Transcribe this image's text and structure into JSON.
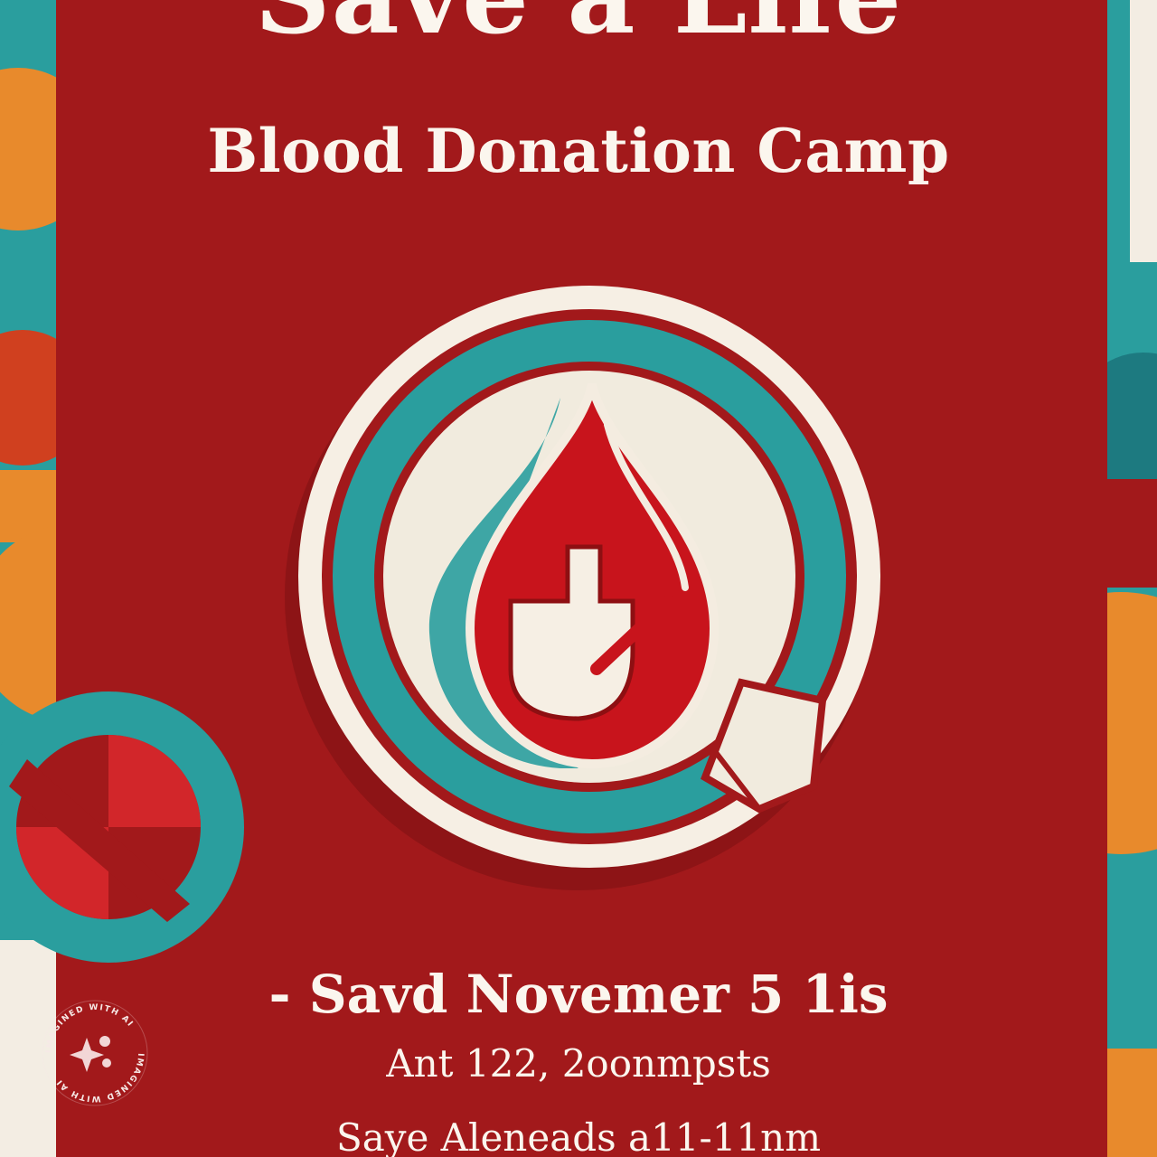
{
  "poster": {
    "title": "Save a Life",
    "subtitle": "Blood Donation Camp",
    "date_line": "- Savd Novemer 5  1is",
    "detail_line": "Ant  122, 2oonmpsts",
    "footer_line": "Saye Aleneads a11-11nm"
  },
  "watermark": {
    "text": "IMAGINED WITH AI",
    "icon": "sparkle-icon"
  },
  "colors": {
    "poster_red": "#a2191b",
    "teal": "#2a9e9e",
    "orange": "#e88a2c",
    "cream": "#f3ede3",
    "drop_red": "#c8141c"
  },
  "emblem": {
    "icon": "blood-drop-icon",
    "secondary_icon": "blood-bag-icon"
  }
}
